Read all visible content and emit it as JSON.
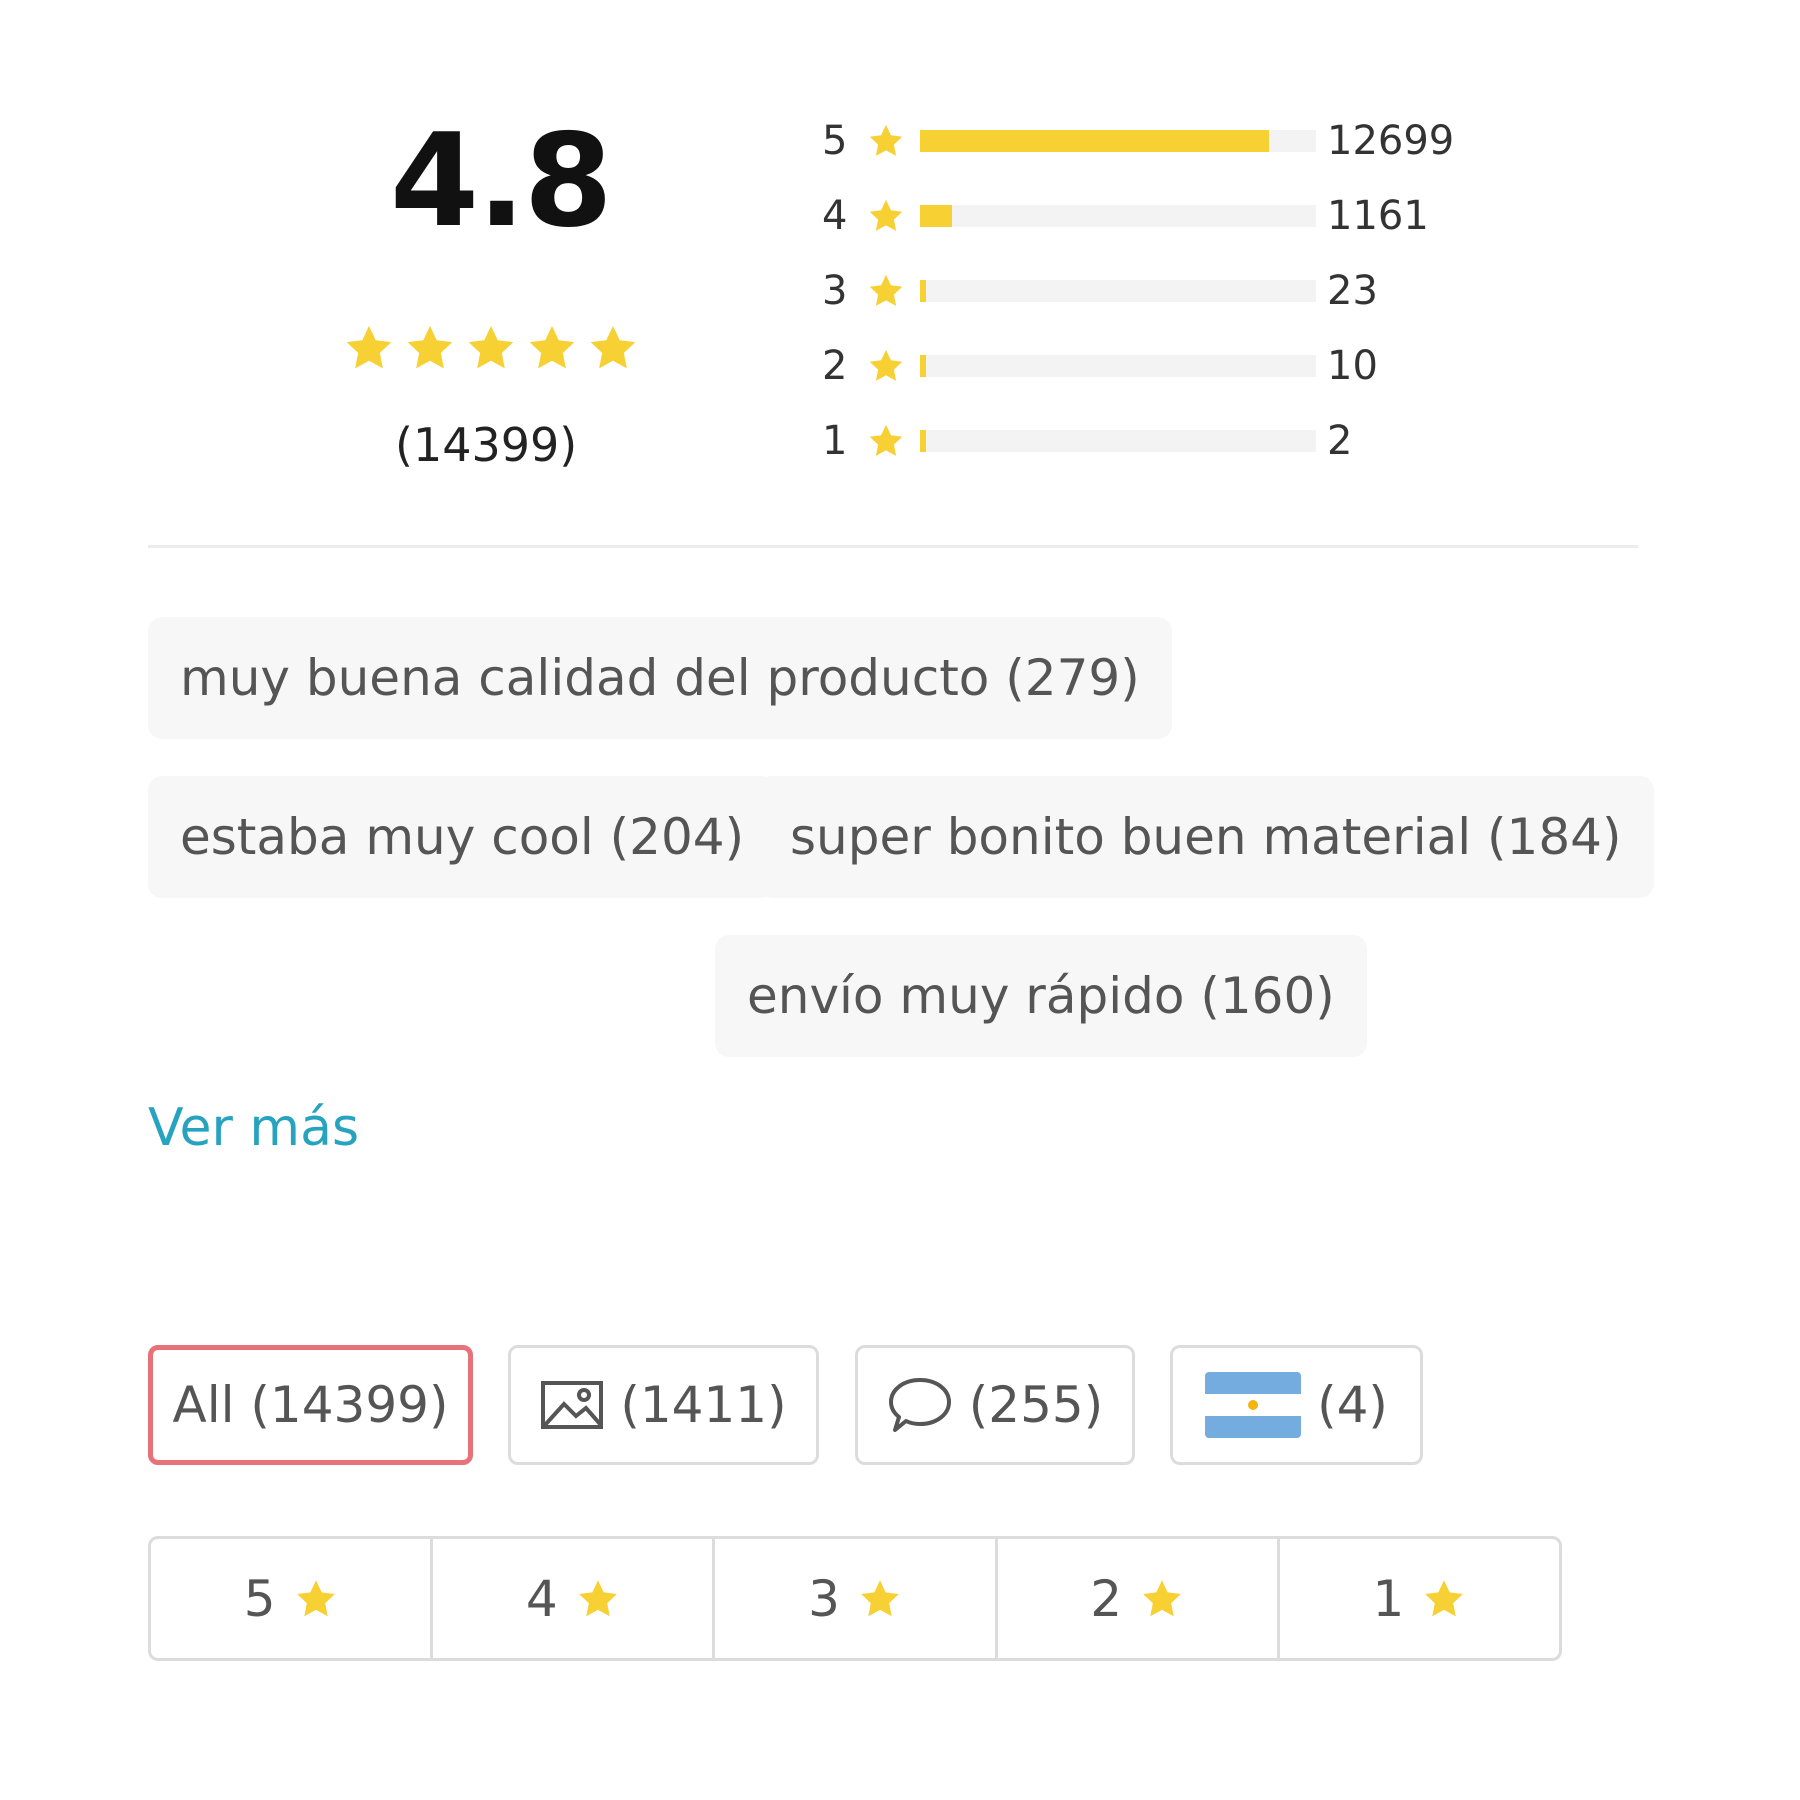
{
  "summary": {
    "average": "4.8",
    "stars_filled": 5,
    "total_label": "(14399)"
  },
  "histogram": [
    {
      "stars": "5",
      "count": "12699",
      "fraction": 0.882
    },
    {
      "stars": "4",
      "count": "1161",
      "fraction": 0.081
    },
    {
      "stars": "3",
      "count": "23",
      "fraction": 0.0016
    },
    {
      "stars": "2",
      "count": "10",
      "fraction": 0.0007
    },
    {
      "stars": "1",
      "count": "2",
      "fraction": 0.0001
    }
  ],
  "tags": [
    "muy buena calidad del producto (279)",
    "estaba muy cool (204)",
    "super bonito buen material (184)",
    "envío muy rápido (160)"
  ],
  "ver_mas": "Ver más",
  "filters": [
    {
      "label": "All (14399)",
      "icon": "none",
      "active": true
    },
    {
      "label": "(1411)",
      "icon": "image-icon",
      "active": false
    },
    {
      "label": "(255)",
      "icon": "comment-icon",
      "active": false
    },
    {
      "label": "(4)",
      "icon": "argentina-flag-icon",
      "active": false
    }
  ],
  "star_filters": [
    "5",
    "4",
    "3",
    "2",
    "1"
  ],
  "colors": {
    "star": "#f7d034",
    "accent_link": "#27a3c0",
    "active_border": "#e8727a"
  }
}
